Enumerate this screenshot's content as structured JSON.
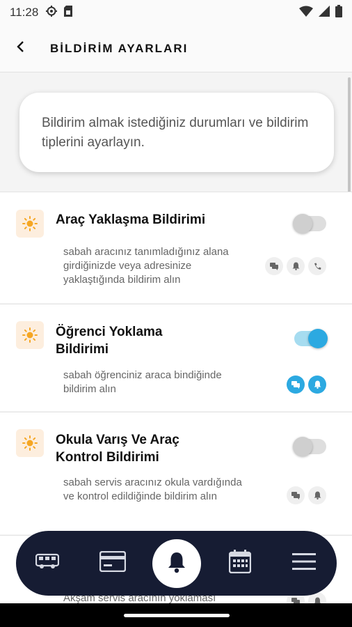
{
  "status_bar": {
    "time": "11:28",
    "left_icons": [
      "settings-icon",
      "sim-card-icon"
    ],
    "right_icons": [
      "wifi-icon",
      "signal-icon",
      "battery-icon"
    ]
  },
  "app_bar": {
    "back_icon": "chevron-left-icon",
    "title": "BİLDİRİM AYARLARI"
  },
  "intro": {
    "text": "Bildirim almak istediğiniz durumları ve bildirim tiplerini ayarlayın."
  },
  "notifications": [
    {
      "title": "Araç Yaklaşma Bildirimi",
      "description": "sabah aracınız tanımladığınız alana girdiğinizde veya adresinize yaklaştığında bildirim alın",
      "enabled": false,
      "channels": [
        {
          "icon": "message-icon",
          "active": false
        },
        {
          "icon": "bell-icon",
          "active": false
        },
        {
          "icon": "phone-icon",
          "active": false
        }
      ]
    },
    {
      "title": "Öğrenci Yoklama Bildirimi",
      "description": "sabah öğrenciniz araca bindiğinde bildirim alın",
      "enabled": true,
      "channels": [
        {
          "icon": "message-icon",
          "active": true
        },
        {
          "icon": "bell-icon",
          "active": true
        }
      ]
    },
    {
      "title": "Okula Varış Ve Araç Kontrol Bildirimi",
      "description": "sabah servis aracınız okula vardığında ve kontrol edildiğinde bildirim alın",
      "enabled": false,
      "channels": [
        {
          "icon": "message-icon",
          "active": false
        },
        {
          "icon": "bell-icon",
          "active": false
        }
      ]
    },
    {
      "title": "",
      "description": "Akşam servis aracının yoklaması",
      "enabled": false,
      "channels": [
        {
          "icon": "message-icon",
          "active": false
        },
        {
          "icon": "bell-icon",
          "active": false
        }
      ]
    }
  ],
  "bottom_nav": {
    "items": [
      "bus-icon",
      "card-icon",
      "bell-icon",
      "calendar-icon",
      "menu-icon"
    ],
    "active": "bell-icon"
  },
  "colors": {
    "accent": "#2ca9e1",
    "nav_bg": "#161c33",
    "sun_bg": "#fdeede",
    "sun": "#f5a623"
  }
}
